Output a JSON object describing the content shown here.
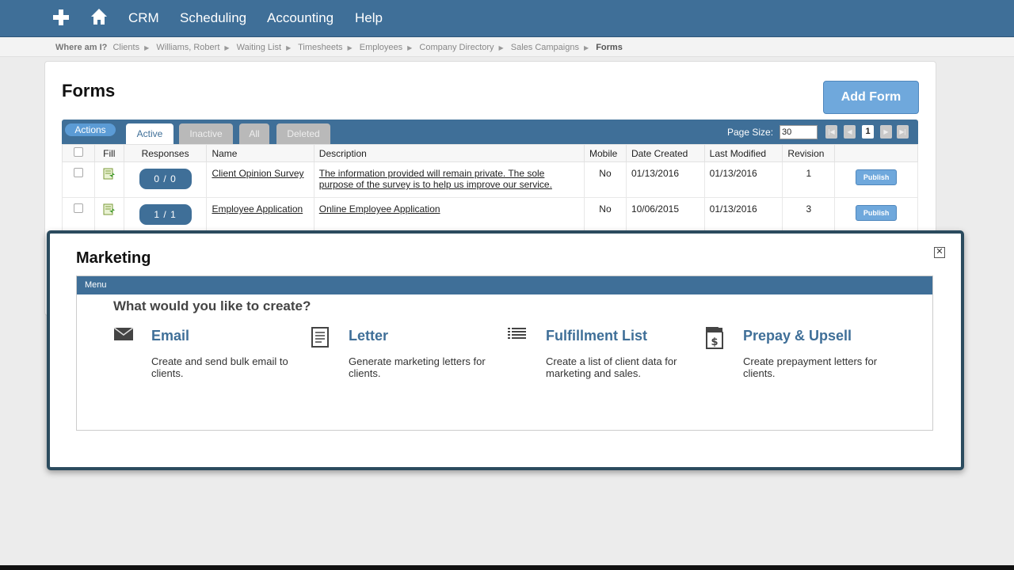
{
  "topnav": {
    "items": [
      "CRM",
      "Scheduling",
      "Accounting",
      "Help"
    ]
  },
  "breadcrumb": {
    "label": "Where am I?",
    "items": [
      "Clients",
      "Williams, Robert",
      "Waiting List",
      "Timesheets",
      "Employees",
      "Company Directory",
      "Sales Campaigns"
    ],
    "current": "Forms"
  },
  "forms_panel": {
    "title": "Forms",
    "add_button": "Add Form",
    "actions_label": "Actions",
    "tabs": [
      "Active",
      "Inactive",
      "All",
      "Deleted"
    ],
    "active_tab": "Active",
    "page_size_label": "Page Size:",
    "page_size_value": "30",
    "current_page": "1",
    "columns": [
      "Fill",
      "Responses",
      "Name",
      "Description",
      "Mobile",
      "Date Created",
      "Last Modified",
      "Revision"
    ],
    "rows": [
      {
        "responses": "0 / 0",
        "name": "Client Opinion Survey",
        "description": "The information provided will remain private. The sole purpose of the survey is to help us improve our service.",
        "mobile": "No",
        "date_created": "01/13/2016",
        "last_modified": "01/13/2016",
        "revision": "1",
        "action": "Publish"
      },
      {
        "responses": "1 / 1",
        "name": "Employee Application",
        "description": "Online Employee Application",
        "mobile": "No",
        "date_created": "10/06/2015",
        "last_modified": "01/13/2016",
        "revision": "3",
        "action": "Publish"
      }
    ]
  },
  "modal": {
    "title": "Marketing",
    "menu_label": "Menu",
    "question": "What would you like to create?",
    "options": [
      {
        "icon": "envelope-icon",
        "title": "Email",
        "description": "Create and send bulk email to clients."
      },
      {
        "icon": "letter-icon",
        "title": "Letter",
        "description": "Generate marketing letters for clients."
      },
      {
        "icon": "list-icon",
        "title": "Fulfillment List",
        "description": "Create a list of client data for marketing and sales."
      },
      {
        "icon": "dollar-document-icon",
        "title": "Prepay & Upsell",
        "description": "Create prepayment letters for clients."
      }
    ]
  },
  "colors": {
    "nav_blue": "#3f6f98",
    "button_blue": "#6fa8dc",
    "modal_border": "#2b4b5e"
  }
}
